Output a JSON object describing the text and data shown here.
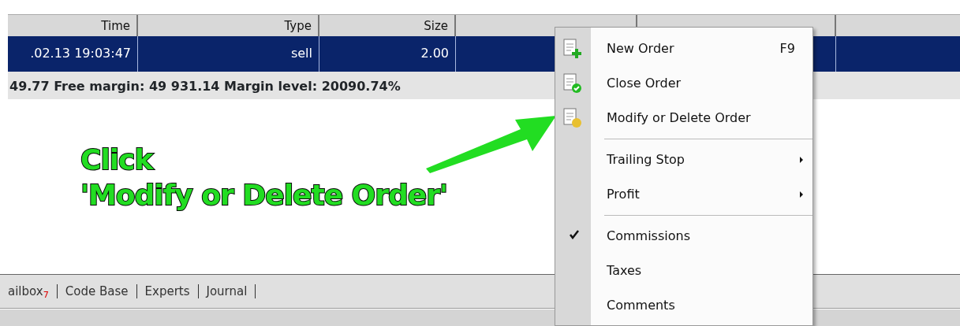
{
  "table": {
    "columns": [
      "Time",
      "Type",
      "Size"
    ],
    "rows": [
      {
        "cells": [
          ".02.13 19:03:47",
          "sell",
          "2.00"
        ],
        "selected": true
      }
    ]
  },
  "summary": "49.77  Free margin: 49 931.14  Margin level: 20090.74%",
  "annotation": {
    "lines": [
      "Click",
      "'Modify or Delete Order'"
    ]
  },
  "tabs": [
    {
      "label": "ailbox$_{7}$",
      "selected": false
    },
    {
      "label": "Code Base",
      "selected": false
    },
    {
      "label": "Experts",
      "selected": false
    },
    {
      "label": "Journal",
      "selected": false
    }
  ],
  "context_menu": [
    {
      "kind": "item",
      "label": "New Order",
      "shortcut": "F9",
      "checked": false,
      "submenu": false
    },
    {
      "kind": "item",
      "label": "Close Order",
      "checked": false,
      "submenu": false
    },
    {
      "kind": "item",
      "label": "Modify or Delete Order",
      "checked": false,
      "submenu": false
    },
    {
      "kind": "separator"
    },
    {
      "kind": "item",
      "label": "Trailing Stop",
      "checked": false,
      "submenu": true
    },
    {
      "kind": "item",
      "label": "Profit",
      "checked": false,
      "submenu": true
    },
    {
      "kind": "separator"
    },
    {
      "kind": "item",
      "label": "Commissions",
      "checked": true,
      "submenu": false
    },
    {
      "kind": "item",
      "label": "Taxes",
      "checked": false,
      "submenu": false
    },
    {
      "kind": "item",
      "label": "Comments",
      "checked": false,
      "submenu": false
    }
  ]
}
